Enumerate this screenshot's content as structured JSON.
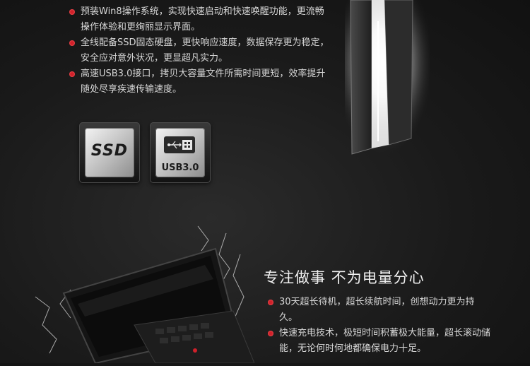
{
  "features_top": [
    "预装Win8操作系统，实现快速启动和快速唤醒功能，更流畅操作体验和更绚丽显示界面。",
    "全线配备SSD固态硬盘，更快响应速度，数据保存更为稳定，安全应对意外状况，更显超凡实力。",
    "高速USB3.0接口，拷贝大容量文件所需时间更短，效率提升随处尽享疾速传输速度。"
  ],
  "badges": {
    "ssd": "SSD",
    "usb": "USB3.0"
  },
  "headline": "专注做事  不为电量分心",
  "features_bottom": [
    "30天超长待机，超长续航时间，创想动力更为持久。",
    "快速充电技术，极短时间积蓄极大能量，超长滚动储能，无论何时何地都确保电力十足。"
  ],
  "colors": {
    "bullet": "#d0202a",
    "background": "#1a1a1a",
    "text": "#d6d6d6"
  }
}
